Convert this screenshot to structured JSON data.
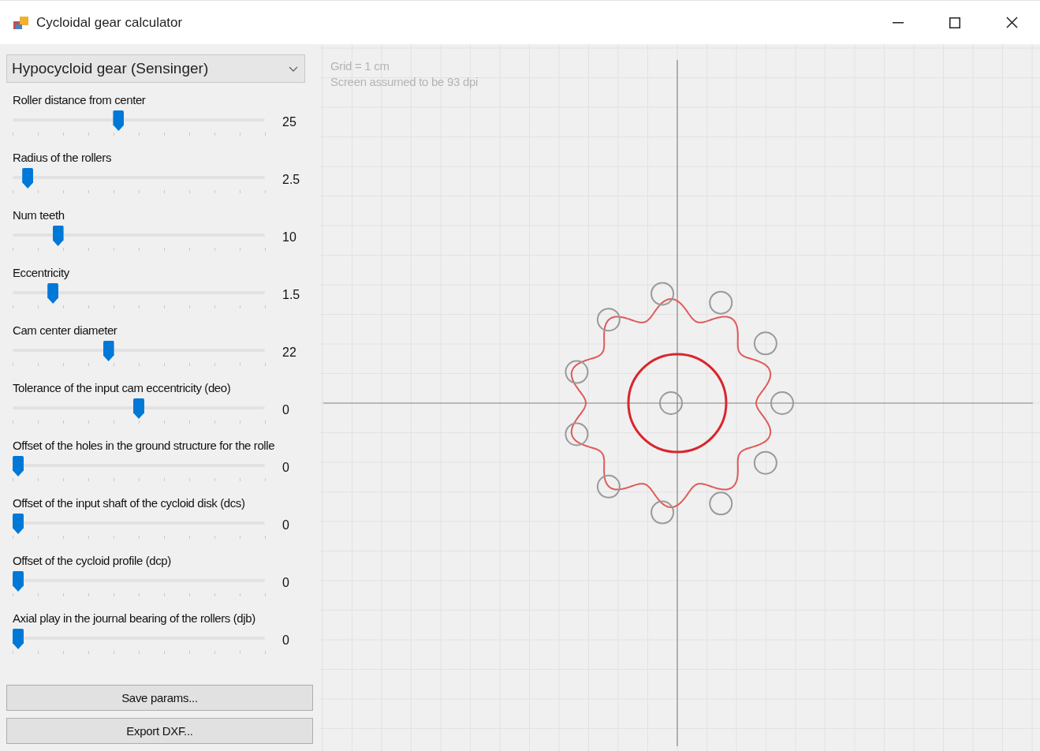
{
  "window": {
    "title": "Cycloidal gear calculator"
  },
  "gear_type": {
    "value": "Hypocycloid gear (Sensinger)"
  },
  "canvas_info": [
    "Grid = 1 cm",
    "Screen assumed to be 93 dpi"
  ],
  "sliders": [
    {
      "label": "Roller distance from center",
      "level": 0.42,
      "reading": "25"
    },
    {
      "label": "Radius of the rollers",
      "level": 0.06,
      "reading": "2.5"
    },
    {
      "label": "Num teeth",
      "level": 0.18,
      "reading": "10"
    },
    {
      "label": "Eccentricity",
      "level": 0.16,
      "reading": "1.5"
    },
    {
      "label": "Cam center diameter",
      "level": 0.38,
      "reading": "22"
    },
    {
      "label": "Tolerance of the input cam eccentricity (deo)",
      "level": 0.5,
      "reading": "0"
    },
    {
      "label": "Offset of the holes in the ground structure for the rolle",
      "level": 0,
      "reading": "0"
    },
    {
      "label": "Offset of the input shaft of the cycloid disk (dcs)",
      "level": 0,
      "reading": "0"
    },
    {
      "label": "Offset of the cycloid profile (dcp)",
      "level": 0,
      "reading": "0"
    },
    {
      "label": "Axial play in the journal bearing of the rollers (djb)",
      "level": 0,
      "reading": "0"
    }
  ],
  "buttons": [
    "Save params...",
    "Export DXF..."
  ]
}
